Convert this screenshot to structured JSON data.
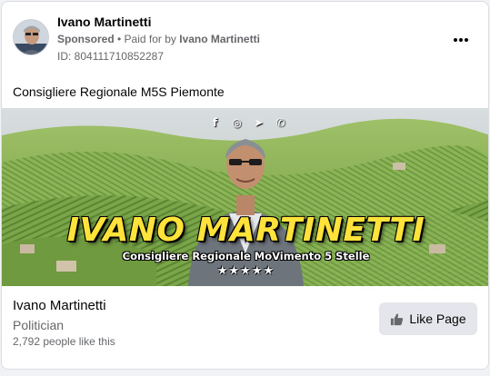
{
  "post": {
    "author": "Ivano Martinetti",
    "sponsored_label": "Sponsored",
    "separator": " • ",
    "paid_prefix": "Paid for by ",
    "paid_by": "Ivano Martinetti",
    "ad_id": "ID: 804111710852287",
    "more_icon": "more-horizontal-icon",
    "body_text": "Consigliere Regionale M5S Piemonte"
  },
  "media": {
    "overlay_name": "IVANO MARTINETTI",
    "overlay_subtitle": "Consigliere Regionale MoVimento 5 Stelle",
    "overlay_stars": "★★★★★",
    "social_icons": [
      "f",
      "◎",
      "➤",
      "✆"
    ],
    "social_icon_names": [
      "facebook-icon",
      "instagram-icon",
      "telegram-icon",
      "whatsapp-icon"
    ]
  },
  "footer": {
    "page_name": "Ivano Martinetti",
    "category": "Politician",
    "likes": "2,792 people like this",
    "like_button_label": "Like Page",
    "like_icon": "thumbs-up-icon"
  },
  "colors": {
    "accent_text": "#ffe23a",
    "secondary_text": "#65676b",
    "button_bg": "#e4e6eb"
  }
}
